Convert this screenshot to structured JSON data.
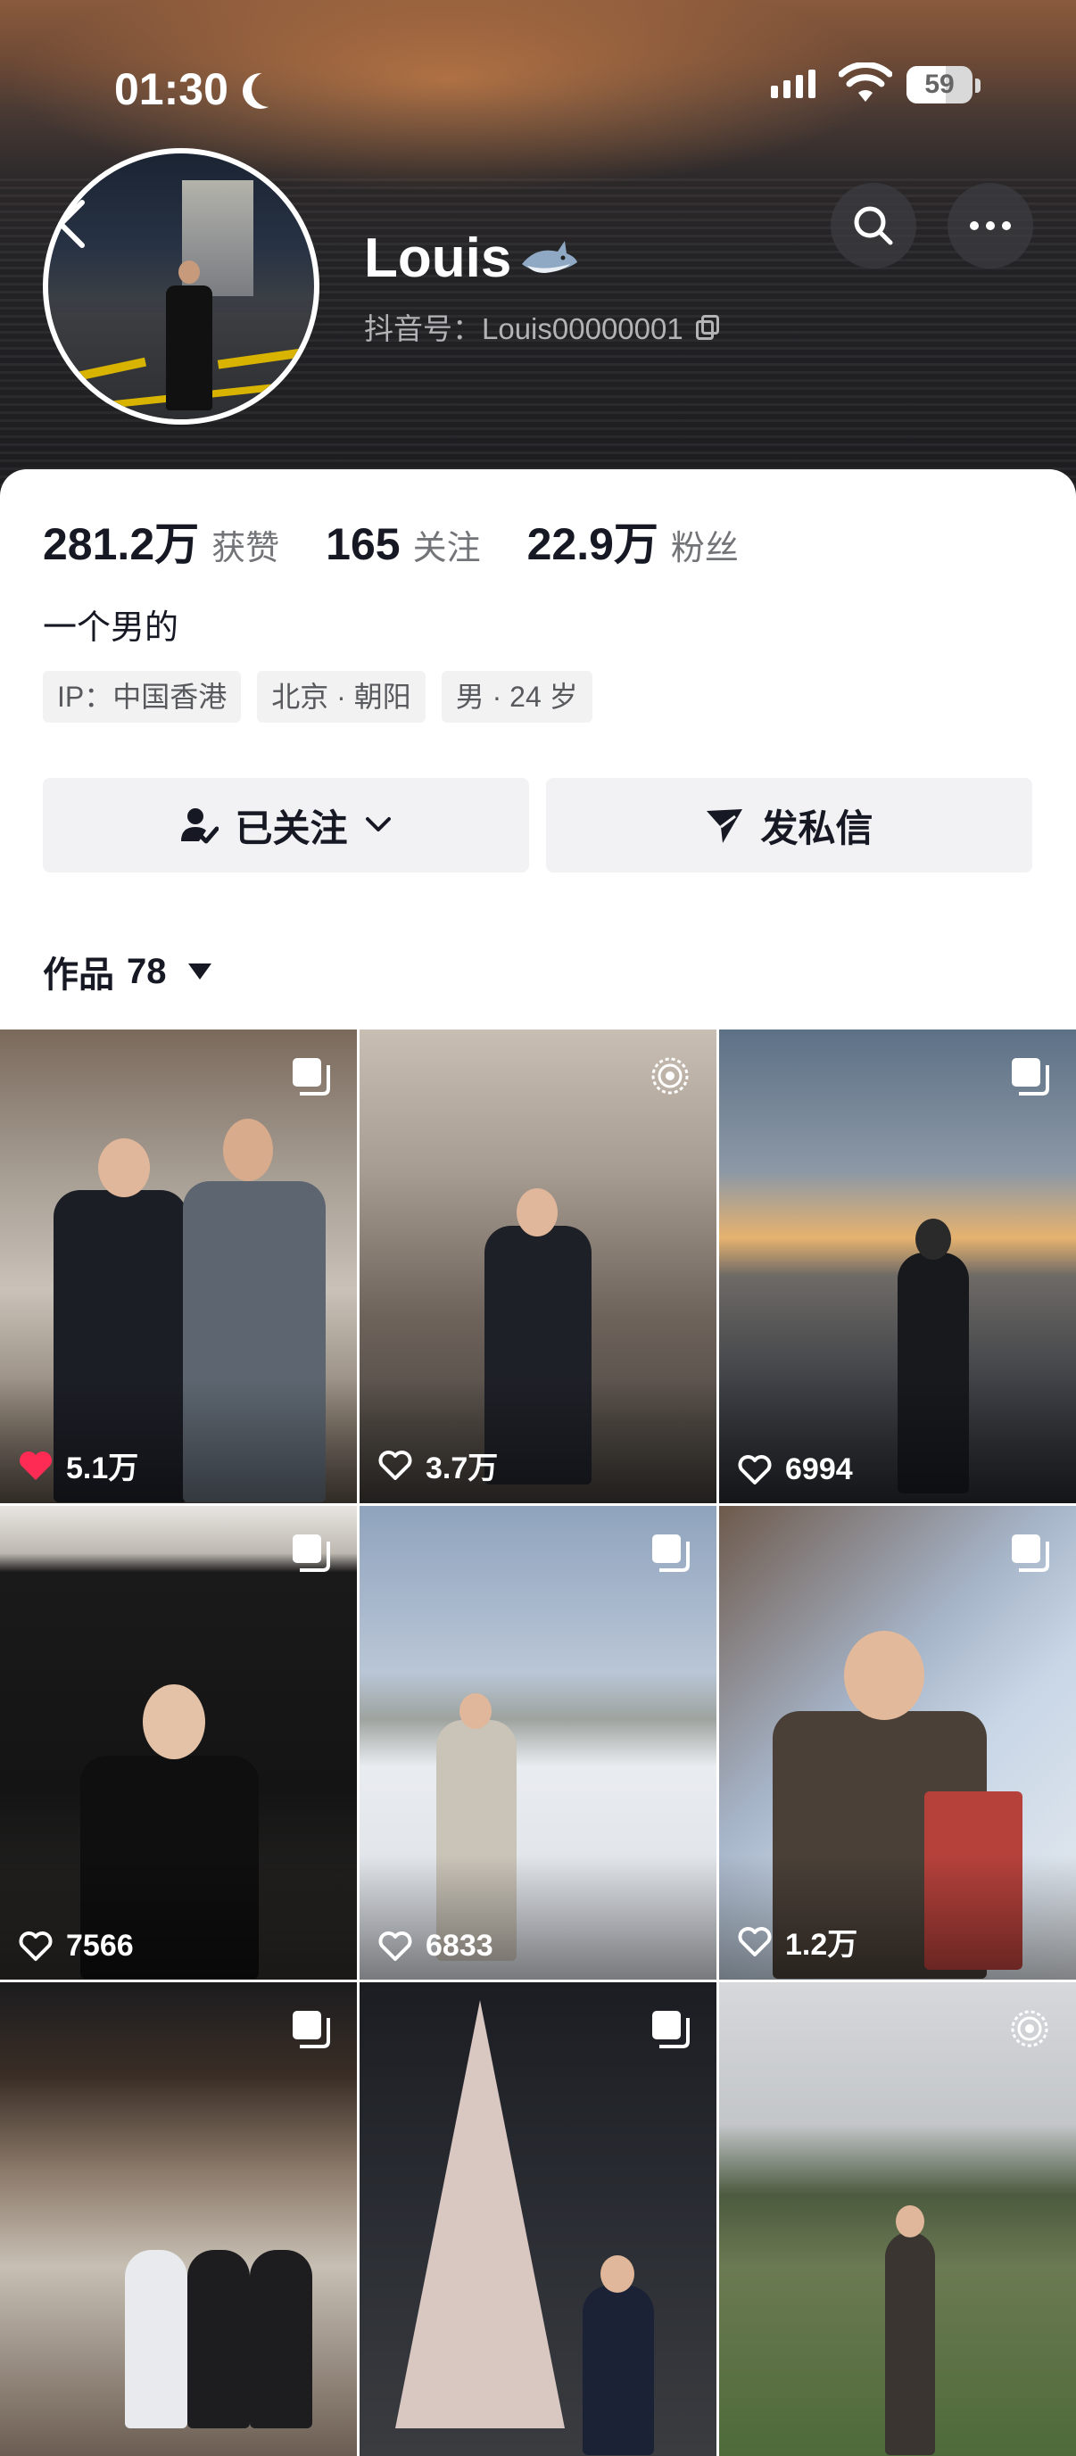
{
  "status_bar": {
    "time": "01:30",
    "battery": "59"
  },
  "profile": {
    "name": "Louis",
    "douyin_id": "抖音号：Louis00000001",
    "bio": "一个男的",
    "tags": [
      "IP：中国香港",
      "北京 · 朝阳",
      "男 · 24 岁"
    ]
  },
  "stats": [
    {
      "value": "281.2万",
      "label": "获赞"
    },
    {
      "value": "165",
      "label": "关注"
    },
    {
      "value": "22.9万",
      "label": "粉丝"
    }
  ],
  "actions": {
    "follow_label": "已关注",
    "message_label": "发私信"
  },
  "works": {
    "label": "作品",
    "count": "78"
  },
  "posts": [
    {
      "likes": "5.1万",
      "liked": true,
      "badge": "gallery-icon"
    },
    {
      "likes": "3.7万",
      "liked": false,
      "badge": "live-photo-icon"
    },
    {
      "likes": "6994",
      "liked": false,
      "badge": "gallery-icon"
    },
    {
      "likes": "7566",
      "liked": false,
      "badge": "gallery-icon"
    },
    {
      "likes": "6833",
      "liked": false,
      "badge": "gallery-icon"
    },
    {
      "likes": "1.2万",
      "liked": false,
      "badge": "gallery-icon"
    },
    {
      "likes": "",
      "liked": false,
      "badge": "gallery-icon"
    },
    {
      "likes": "",
      "liked": false,
      "badge": "gallery-icon"
    },
    {
      "likes": "",
      "liked": false,
      "badge": "live-photo-icon"
    }
  ],
  "colors": {
    "like_red": "#fe2c55",
    "text": "#161823"
  }
}
